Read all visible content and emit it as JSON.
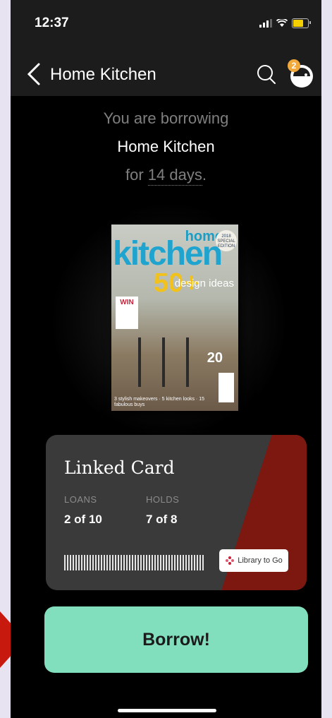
{
  "status_bar": {
    "time": "12:37"
  },
  "nav": {
    "title": "Home Kitchen",
    "notification_count": "2"
  },
  "intro": {
    "line1": "You are borrowing",
    "title": "Home Kitchen",
    "for_prefix": "for ",
    "duration": "14 days",
    "for_suffix": "."
  },
  "cover": {
    "home": "home",
    "kitchen": "kitchen",
    "badge": "2018 SPECIAL EDITION",
    "fifty": "50+",
    "design": "design ideas",
    "win": "WIN",
    "twenty": "20",
    "footer": "3 stylish makeovers · 5 kitchen looks · 15 fabulous buys"
  },
  "card": {
    "title": "Linked Card",
    "loans_label": "LOANS",
    "loans_value": "2 of 10",
    "holds_label": "HOLDS",
    "holds_value": "7 of 8",
    "library_name": "Library to Go",
    "accent_color": "#7d1810"
  },
  "borrow": {
    "label": "Borrow!",
    "color": "#82dfbe"
  },
  "arrow_color": "#c8190f"
}
